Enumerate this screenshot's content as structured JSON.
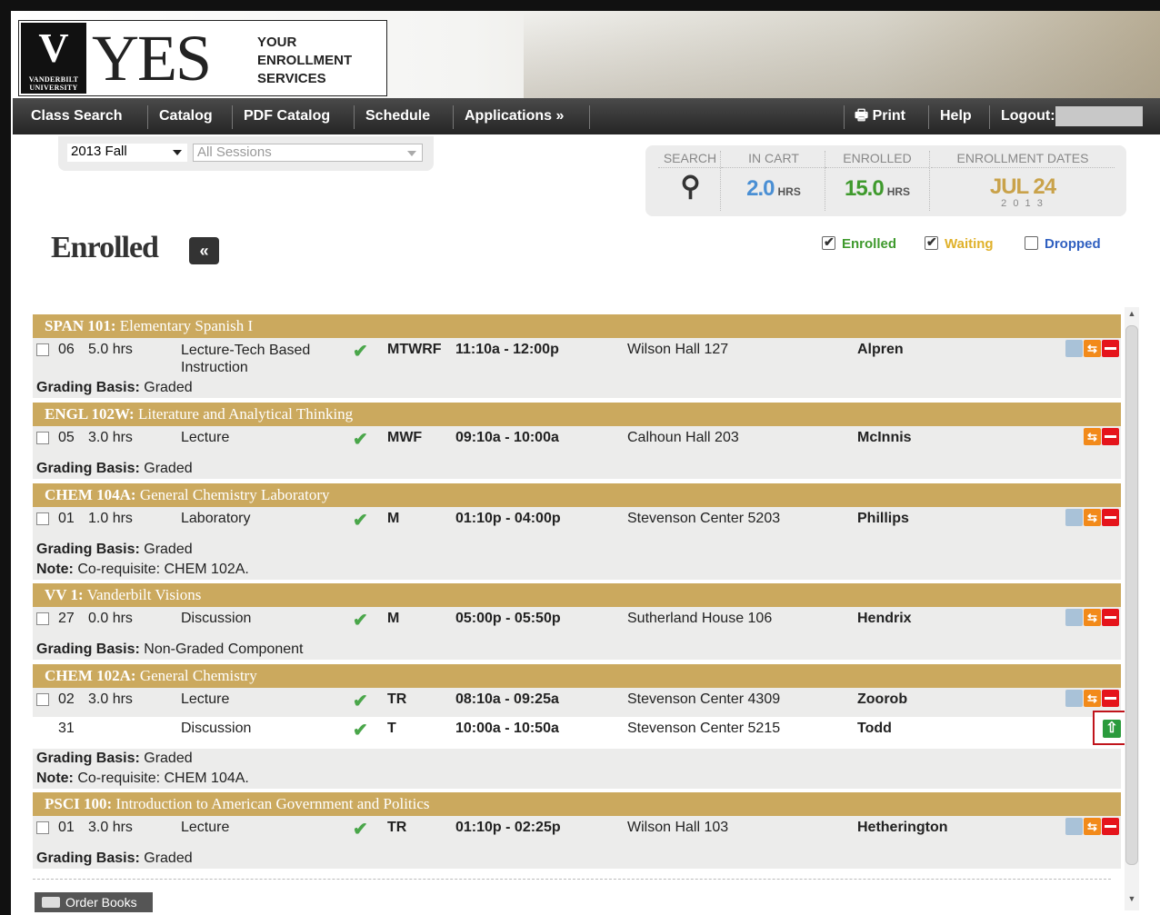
{
  "logo": {
    "shield_letter": "V",
    "university": "VANDERBILT UNIVERSITY",
    "yes": "YES",
    "line1": "YOUR",
    "line2": "ENROLLMENT",
    "line3": "SERVICES"
  },
  "nav": {
    "class_search": "Class Search",
    "catalog": "Catalog",
    "pdf_catalog": "PDF Catalog",
    "schedule": "Schedule",
    "applications": "Applications »",
    "print": "Print",
    "help": "Help",
    "logout": "Logout:"
  },
  "term": {
    "selected": "2013 Fall",
    "sessions_placeholder": "All Sessions"
  },
  "stats": {
    "search_label": "SEARCH",
    "in_cart_label": "IN CART",
    "in_cart_value": "2.0",
    "in_cart_unit": "HRS",
    "enrolled_label": "ENROLLED",
    "enrolled_value": "15.0",
    "enrolled_unit": "HRS",
    "dates_label": "ENROLLMENT DATES",
    "date_main": "JUL 24",
    "date_year": "2 0 1 3"
  },
  "page": {
    "title": "Enrolled",
    "collapse": "«"
  },
  "filters": {
    "enrolled": "Enrolled",
    "waiting": "Waiting",
    "dropped": "Dropped",
    "enrolled_checked": true,
    "waiting_checked": true,
    "dropped_checked": false
  },
  "colors": {
    "accent": "#cba95e",
    "enrolled": "#3f9a2d",
    "waiting": "#e0b12a",
    "dropped": "#3060c0",
    "in_cart": "#4a8fd4",
    "date": "#c9a24a"
  },
  "courses": [
    {
      "code": "SPAN 101:",
      "name": " Elementary Spanish I",
      "sections": [
        {
          "sec": "06",
          "hrs": "5.0 hrs",
          "type": "Lecture-Tech Based",
          "type2": "Instruction",
          "days": "MTWRF",
          "time": "11:10a - 12:00p",
          "room": "Wilson Hall 127",
          "instructor": "Alpren"
        }
      ],
      "grading_label": "Grading Basis:",
      "grading": " Graded"
    },
    {
      "code": "ENGL 102W:",
      "name": " Literature and Analytical Thinking",
      "sections": [
        {
          "sec": "05",
          "hrs": "3.0 hrs",
          "type": "Lecture",
          "days": "MWF",
          "time": "09:10a - 10:00a",
          "room": "Calhoun Hall 203",
          "instructor": "McInnis"
        }
      ],
      "grading_label": "Grading Basis:",
      "grading": " Graded"
    },
    {
      "code": "CHEM 104A:",
      "name": " General Chemistry Laboratory",
      "sections": [
        {
          "sec": "01",
          "hrs": "1.0 hrs",
          "type": "Laboratory",
          "days": "M",
          "time": "01:10p - 04:00p",
          "room": "Stevenson Center 5203",
          "instructor": "Phillips"
        }
      ],
      "grading_label": "Grading Basis:",
      "grading": " Graded",
      "note_label": "Note:",
      "note": " Co-requisite: CHEM 102A."
    },
    {
      "code": "VV 1:",
      "name": " Vanderbilt Visions",
      "sections": [
        {
          "sec": "27",
          "hrs": "0.0 hrs",
          "type": "Discussion",
          "days": "M",
          "time": "05:00p - 05:50p",
          "room": "Sutherland House 106",
          "instructor": "Hendrix"
        }
      ],
      "grading_label": "Grading Basis:",
      "grading": " Non-Graded Component"
    },
    {
      "code": "CHEM 102A:",
      "name": " General Chemistry",
      "sections": [
        {
          "sec": "02",
          "hrs": "3.0 hrs",
          "type": "Lecture",
          "days": "TR",
          "time": "08:10a - 09:25a",
          "room": "Stevenson Center 4309",
          "instructor": "Zoorob"
        },
        {
          "sec": "31",
          "type": "Discussion",
          "days": "T",
          "time": "10:00a - 10:50a",
          "room": "Stevenson Center 5215",
          "instructor": "Todd"
        }
      ],
      "grading_label": "Grading Basis:",
      "grading": " Graded",
      "note_label": "Note:",
      "note": " Co-requisite: CHEM 104A."
    },
    {
      "code": "PSCI 100:",
      "name": " Introduction to American Government and Politics",
      "sections": [
        {
          "sec": "01",
          "hrs": "3.0 hrs",
          "type": "Lecture",
          "days": "TR",
          "time": "01:10p - 02:25p",
          "room": "Wilson Hall 103",
          "instructor": "Hetherington"
        }
      ],
      "grading_label": "Grading Basis:",
      "grading": " Graded"
    }
  ],
  "footer": {
    "order_books": "Order Books"
  },
  "icons": {
    "search": "search-icon",
    "check": "checkmark-icon",
    "edit": "edit-icon",
    "swap": "swap-icon",
    "drop": "drop-icon",
    "up": "move-up-icon",
    "print": "printer-icon",
    "book": "book-icon"
  }
}
